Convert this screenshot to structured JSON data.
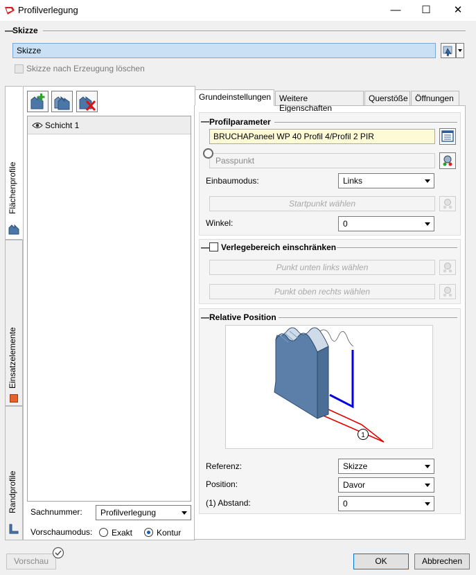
{
  "window": {
    "title": "Profilverlegung",
    "minimize_glyph": "—",
    "maximize_glyph": "☐",
    "close_glyph": "✕"
  },
  "skizze": {
    "header": "Skizze",
    "value": "Skizze",
    "delete_checkbox_label": "Skizze nach Erzeugung löschen",
    "delete_checked": false
  },
  "side_tabs": [
    {
      "label": "Flächenprofile",
      "icon": "surface-profile-icon",
      "active": true
    },
    {
      "label": "Einsatzelemente",
      "icon": "insert-element-icon",
      "active": false
    },
    {
      "label": "Randprofile",
      "icon": "edge-profile-icon",
      "active": false
    }
  ],
  "toolbar": {
    "add_icon": "add-layer-icon",
    "copy_icon": "copy-layer-icon",
    "delete_icon": "delete-layer-icon"
  },
  "layers": [
    {
      "name": "Schicht 1",
      "visible": true
    }
  ],
  "left_bottom": {
    "sachnummer_label": "Sachnummer:",
    "sachnummer_value": "Profilverlegung",
    "vorschaumodus_label": "Vorschaumodus:",
    "radio_exakt": "Exakt",
    "radio_kontur": "Kontur",
    "selected": "Kontur"
  },
  "tabs": [
    {
      "label": "Grundeinstellungen",
      "active": true
    },
    {
      "label": "Weitere Eigenschaften",
      "active": false
    },
    {
      "label": "Querstöße",
      "active": false
    },
    {
      "label": "Öffnungen",
      "active": false
    }
  ],
  "profilparameter": {
    "header": "Profilparameter",
    "profile": "BRUCHAPaneel WP 40 Profil 4/Profil 2 PIR",
    "passpunkt": "Passpunkt",
    "einbaumodus_label": "Einbaumodus:",
    "einbaumodus_value": "Links",
    "startpunkt_button": "Startpunkt wählen",
    "winkel_label": "Winkel:",
    "winkel_value": "0"
  },
  "verlegebereich": {
    "header": "Verlegebereich einschränken",
    "checked": false,
    "punkt_unten_links": "Punkt unten links wählen",
    "punkt_oben_rechts": "Punkt oben rechts wählen"
  },
  "relative_position": {
    "header": "Relative Position",
    "marker": "1",
    "referenz_label": "Referenz:",
    "referenz_value": "Skizze",
    "position_label": "Position:",
    "position_value": "Davor",
    "abstand_label": "(1) Abstand:",
    "abstand_value": "0"
  },
  "footer": {
    "vorschau": "Vorschau",
    "ok": "OK",
    "abbrechen": "Abbrechen"
  },
  "colors": {
    "accent_field": "#c9e0f5",
    "profile_field": "#fdfbd6",
    "panel_blue": "#5b7fa8",
    "line_red": "#e00000",
    "line_blue": "#0000e0"
  }
}
